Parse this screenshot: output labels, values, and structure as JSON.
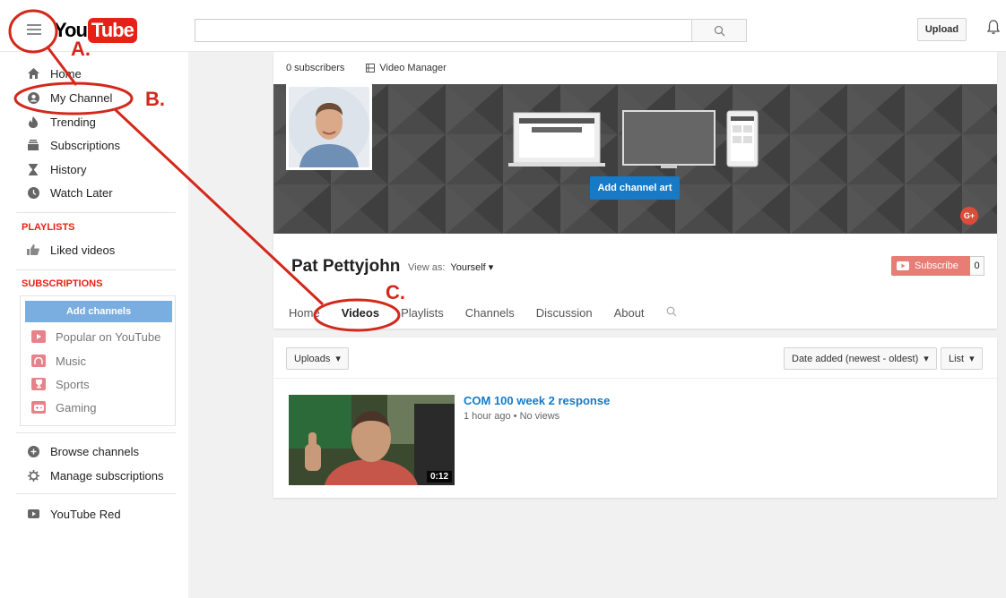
{
  "header": {
    "logo_you": "You",
    "logo_tube": "Tube",
    "search_placeholder": "",
    "upload_label": "Upload"
  },
  "sidebar": {
    "items": [
      {
        "label": "Home",
        "icon": "home-icon"
      },
      {
        "label": "My Channel",
        "icon": "user-circle-icon"
      },
      {
        "label": "Trending",
        "icon": "flame-icon"
      },
      {
        "label": "Subscriptions",
        "icon": "subscriptions-icon"
      },
      {
        "label": "History",
        "icon": "hourglass-icon"
      },
      {
        "label": "Watch Later",
        "icon": "clock-icon"
      }
    ],
    "playlists_title": "PLAYLISTS",
    "liked_videos": "Liked videos",
    "subscriptions_title": "SUBSCRIPTIONS",
    "add_channels": "Add channels",
    "subscriptions": [
      {
        "label": "Popular on YouTube",
        "icon": "popular-icon"
      },
      {
        "label": "Music",
        "icon": "headphones-icon"
      },
      {
        "label": "Sports",
        "icon": "trophy-icon"
      },
      {
        "label": "Gaming",
        "icon": "gamepad-icon"
      }
    ],
    "browse_channels": "Browse channels",
    "manage_subscriptions": "Manage subscriptions",
    "youtube_red": "YouTube Red"
  },
  "channel": {
    "subscribers_text": "0 subscribers",
    "video_manager": "Video Manager",
    "add_channel_art": "Add channel art",
    "gplus": "G+",
    "name": "Pat Pettyjohn",
    "view_as_label": "View as:",
    "view_as_value": "Yourself",
    "subscribe_label": "Subscribe",
    "subscribe_count": "0",
    "tabs": [
      "Home",
      "Videos",
      "Playlists",
      "Channels",
      "Discussion",
      "About"
    ]
  },
  "videos": {
    "uploads_label": "Uploads",
    "sort_label": "Date added (newest - oldest)",
    "view_label": "List",
    "items": [
      {
        "title": "COM 100 week 2 response",
        "meta": "1 hour ago • No views",
        "duration": "0:12"
      }
    ]
  },
  "annotations": {
    "a": "A.",
    "b": "B.",
    "c": "C."
  },
  "colors": {
    "brand_red": "#e62117",
    "link_blue": "#167ac6",
    "annotation_red": "#d3281b"
  }
}
